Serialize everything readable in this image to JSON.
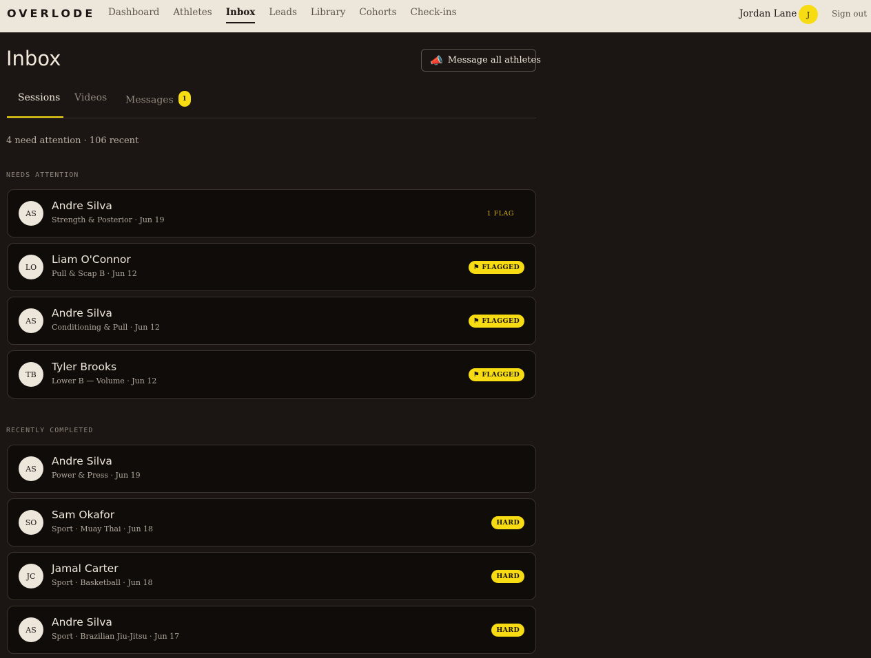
{
  "app": {
    "logo": "OVERLODE",
    "nav": [
      "Dashboard",
      "Athletes",
      "Inbox",
      "Leads",
      "Library",
      "Cohorts",
      "Check-ins"
    ],
    "active_nav": "Inbox",
    "user_name": "Jordan Lane",
    "user_initial": "J",
    "sign_out": "Sign out"
  },
  "page": {
    "title": "Inbox",
    "message_all_label": "Message all athletes",
    "message_all_icon": "megaphone-icon"
  },
  "tabs": [
    {
      "label": "Sessions",
      "active": true,
      "badge": ""
    },
    {
      "label": "Videos",
      "active": false,
      "badge": ""
    },
    {
      "label": "Messages",
      "active": false,
      "badge": "1"
    }
  ],
  "summary": "4 need attention · 106 recent",
  "sections": {
    "needs_attention": {
      "label": "NEEDS ATTENTION",
      "rows": [
        {
          "initials": "AS",
          "name": "Andre Silva",
          "sub": "Strength & Posterior · Jun 19",
          "badge": "1 FLAG",
          "badge_style": "text"
        },
        {
          "initials": "LO",
          "name": "Liam O'Connor",
          "sub": "Pull & Scap B · Jun 12",
          "badge": "⚑ FLAGGED",
          "badge_style": "pill"
        },
        {
          "initials": "AS",
          "name": "Andre Silva",
          "sub": "Conditioning & Pull · Jun 12",
          "badge": "⚑ FLAGGED",
          "badge_style": "pill"
        },
        {
          "initials": "TB",
          "name": "Tyler Brooks",
          "sub": "Lower B — Volume · Jun 12",
          "badge": "⚑ FLAGGED",
          "badge_style": "pill"
        }
      ]
    },
    "recently_completed": {
      "label": "RECENTLY COMPLETED",
      "rows": [
        {
          "initials": "AS",
          "name": "Andre Silva",
          "sub": "Power & Press · Jun 19",
          "badge": "",
          "badge_style": ""
        },
        {
          "initials": "SO",
          "name": "Sam Okafor",
          "sub": "Sport · Muay Thai · Jun 18",
          "badge": "HARD",
          "badge_style": "pill"
        },
        {
          "initials": "JC",
          "name": "Jamal Carter",
          "sub": "Sport · Basketball · Jun 18",
          "badge": "HARD",
          "badge_style": "pill"
        },
        {
          "initials": "AS",
          "name": "Andre Silva",
          "sub": "Sport · Brazilian Jiu-Jitsu · Jun 17",
          "badge": "HARD",
          "badge_style": "pill"
        }
      ]
    }
  },
  "colors": {
    "background": "#1b1613",
    "topbar": "#ece6db",
    "accent": "#f7dc14",
    "card": "#100c0a",
    "border": "#3a332d"
  }
}
